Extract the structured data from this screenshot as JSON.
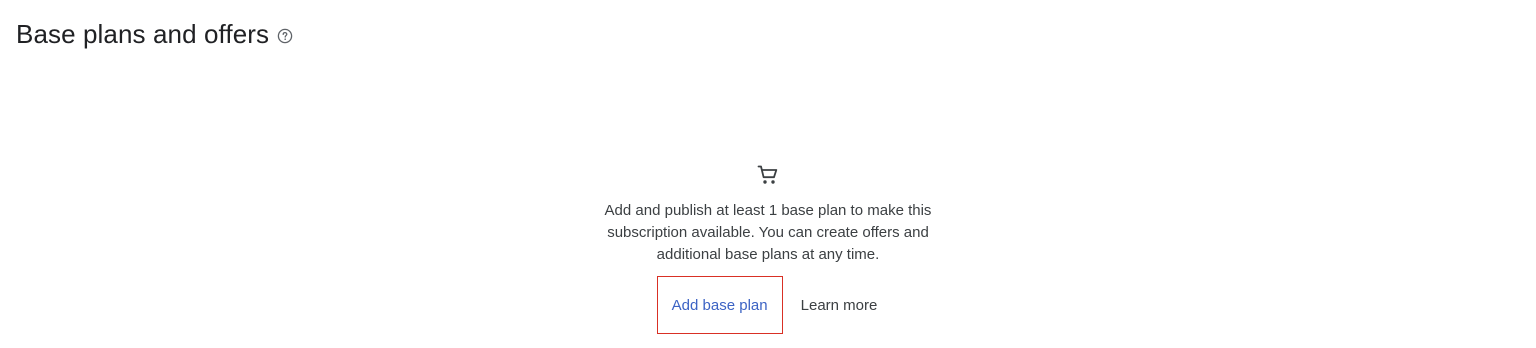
{
  "header": {
    "title": "Base plans and offers",
    "help_icon": "help-circle-icon"
  },
  "empty_state": {
    "icon": "shopping-cart-icon",
    "message": "Add and publish at least 1 base plan to make this subscription available. You can create offers and additional base plans at any time.",
    "primary_action_label": "Add base plan",
    "secondary_action_label": "Learn more"
  },
  "colors": {
    "link_blue": "#3c63c4",
    "highlight_red": "#d93025",
    "text_dark": "#202124"
  }
}
